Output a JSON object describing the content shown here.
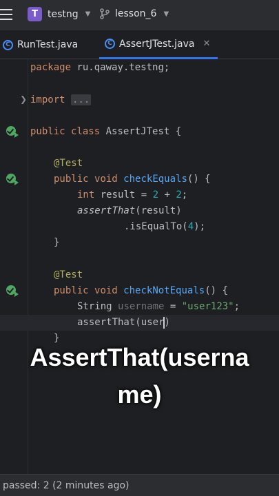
{
  "titlebar": {
    "project_initial": "T",
    "project_name": "testng",
    "branch_name": "lesson_6"
  },
  "tabs": [
    {
      "label": "RunTest.java",
      "active": false
    },
    {
      "label": "AssertJTest.java",
      "active": true
    }
  ],
  "editor": {
    "package_kw": "package",
    "package_name": " ru.qaway.testng;",
    "import_kw": "import",
    "import_fold": "...",
    "class_decl": {
      "public": "public",
      "class": "class",
      "name": " AssertJTest {"
    },
    "test_ann_1": "@Test",
    "method1": {
      "public": "public",
      "void": "void",
      "name": "checkEquals",
      "rest": "() {"
    },
    "int_kw": "int",
    "result_decl": " result = ",
    "num_2a": "2",
    "plus": " + ",
    "num_2b": "2",
    "semicolon": ";",
    "assert_call": "assertThat",
    "assert_arg": "(result)",
    "is_equal": ".isEqualTo(",
    "num_4": "4",
    "is_equal_end": ");",
    "close_brace_1": "}",
    "test_ann_2": "@Test",
    "method2": {
      "public": "public",
      "void": "void",
      "name": "checkNotEquals",
      "rest": "() {"
    },
    "string_type": "String ",
    "username_var": "username",
    "assign": " = ",
    "username_value": "\"user123\"",
    "semicolon2": ";",
    "assert_call_2": "assertThat(user",
    "assert_call_2_end": ")",
    "close_brace_2": "}"
  },
  "caption": {
    "line1": "AssertThat(userna",
    "line2": "me)"
  },
  "status": {
    "text": "passed: 2 (2 minutes ago)"
  },
  "colors": {
    "accent": "#3574f0",
    "run_green": "#4fa862",
    "keyword": "#cf8e6d",
    "function": "#56a8f5",
    "string": "#6aab73",
    "number": "#2aacb8",
    "annotation": "#b3ae60"
  }
}
